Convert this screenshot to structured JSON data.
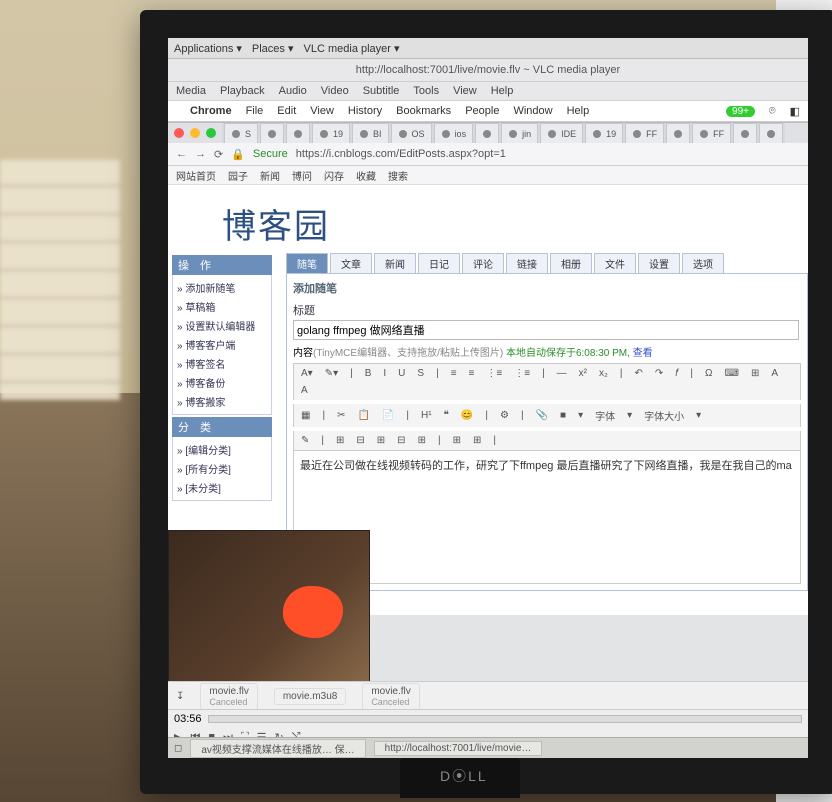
{
  "gnome": {
    "applications": "Applications",
    "places": "Places",
    "vlc": "VLC media player"
  },
  "vlc_window": {
    "title": "http://localhost:7001/live/movie.flv ~ VLC media player",
    "menu": [
      "Media",
      "Playback",
      "Audio",
      "Video",
      "Subtitle",
      "Tools",
      "View",
      "Help"
    ],
    "elapsed": "03:56"
  },
  "mac_menu": {
    "app": "Chrome",
    "items": [
      "File",
      "Edit",
      "View",
      "History",
      "Bookmarks",
      "People",
      "Window",
      "Help"
    ],
    "badge": "99+"
  },
  "chrome": {
    "tabs": [
      {
        "label": "S"
      },
      {
        "label": ""
      },
      {
        "label": ""
      },
      {
        "label": "19"
      },
      {
        "label": "BI"
      },
      {
        "label": "OS"
      },
      {
        "label": "ios"
      },
      {
        "label": ""
      },
      {
        "label": "jin"
      },
      {
        "label": "IDE"
      },
      {
        "label": "19"
      },
      {
        "label": "FF"
      },
      {
        "label": ""
      },
      {
        "label": "FF"
      },
      {
        "label": ""
      },
      {
        "label": ""
      }
    ],
    "secure": "Secure",
    "url": "https://i.cnblogs.com/EditPosts.aspx?opt=1",
    "bookmarks": [
      "网站首页",
      "园子",
      "新闻",
      "博问",
      "闪存",
      "收藏",
      "搜索"
    ]
  },
  "blog": {
    "logo": "博客园",
    "op_head": "操 作",
    "ops": [
      "添加新随笔",
      "草稿箱",
      "设置默认编辑器",
      "博客客户端",
      "博客签名",
      "博客备份",
      "博客搬家"
    ],
    "cat_head": "分 类",
    "cats": [
      "[编辑分类]",
      "[所有分类]",
      "[未分类]"
    ],
    "tabs": [
      "随笔",
      "文章",
      "新闻",
      "日记",
      "评论",
      "链接",
      "相册",
      "文件",
      "设置",
      "选项"
    ],
    "section": "添加随笔",
    "lbl_title": "标题",
    "title_value": "golang ffmpeg 做网络直播",
    "lbl_content_prefix": "内容",
    "lbl_content_hint": "(TinyMCE编辑器、支持拖放/粘贴上传图片)",
    "autosave": "本地自动保存于6:08:30 PM,",
    "autosave_link": "查看",
    "toolbar": [
      "A▾",
      "✎▾",
      "|",
      "B",
      "I",
      "U",
      "S",
      "|",
      "≡",
      "≡",
      "⋮≡",
      "⋮≡",
      "|",
      "—",
      "x²",
      "x₂",
      "|",
      "↶",
      "↷",
      "𝑓",
      "|",
      "Ω",
      "⌨",
      "⊞",
      "A",
      "A"
    ],
    "toolbar2": [
      "▦",
      "|",
      "✂",
      "📋",
      "📄",
      "|",
      "H¹",
      "❝",
      "😊",
      "|",
      "⚙",
      "|",
      "📎",
      "■",
      "▾",
      "字体",
      "▾",
      "字体大小",
      "▾"
    ],
    "toolbar3": [
      "✎",
      "|",
      "⊞",
      "⊟",
      "⊞",
      "⊟",
      "⊞",
      "|",
      "⊞",
      "⊞",
      "|"
    ],
    "body": "最近在公司做在线视频转码的工作，研究了下ffmpeg 最后直播研究了下网络直播，我是在我自己的ma"
  },
  "downloads": [
    {
      "name": "movie.flv",
      "status": "Canceled"
    },
    {
      "name": "movie.m3u8",
      "status": ""
    },
    {
      "name": "movie.flv",
      "status": "Canceled"
    }
  ],
  "taskbar": [
    "av视频支撑流媒体在线播放…  保…",
    "http://localhost:7001/live/movie…"
  ]
}
